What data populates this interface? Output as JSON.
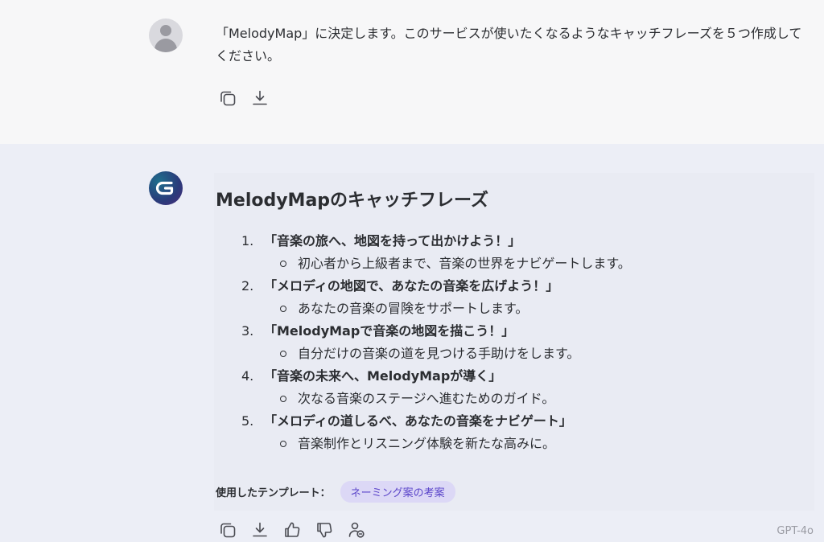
{
  "user": {
    "avatar_icon": "user-avatar-icon",
    "message": "「MelodyMap」に決定します。このサービスが使いたくなるようなキャッチフレーズを５つ作成してください。",
    "actions": [
      {
        "icon": "copy-icon",
        "label": "Copy"
      },
      {
        "icon": "download-icon",
        "label": "Download"
      }
    ]
  },
  "assistant": {
    "avatar_icon": "g-logo-icon",
    "title": "MelodyMapのキャッチフレーズ",
    "phrases": [
      {
        "num": "1.",
        "title": "「音楽の旅へ、地図を持って出かけよう！」",
        "desc": "初心者から上級者まで、音楽の世界をナビゲートします。"
      },
      {
        "num": "2.",
        "title": "「メロディの地図で、あなたの音楽を広げよう！」",
        "desc": "あなたの音楽の冒険をサポートします。"
      },
      {
        "num": "3.",
        "title": "「MelodyMapで音楽の地図を描こう！」",
        "desc": "自分だけの音楽の道を見つける手助けをします。"
      },
      {
        "num": "4.",
        "title": "「音楽の未来へ、MelodyMapが導く」",
        "desc": "次なる音楽のステージへ進むためのガイド。"
      },
      {
        "num": "5.",
        "title": "「メロディの道しるべ、あなたの音楽をナビゲート」",
        "desc": "音楽制作とリスニング体験を新たな高みに。"
      }
    ],
    "template_label": "使用したテンプレート：",
    "template_chip": "ネーミング案の考案",
    "model": "GPT-4o",
    "actions": [
      "copy-icon",
      "download-icon",
      "thumbs-up-icon",
      "thumbs-down-icon",
      "regenerate-icon"
    ]
  },
  "colors": {
    "user_bg": "#f7f7f8",
    "assistant_bg": "#eceef6",
    "chip_bg": "#dcd8f6",
    "chip_text": "#5a44c9"
  }
}
